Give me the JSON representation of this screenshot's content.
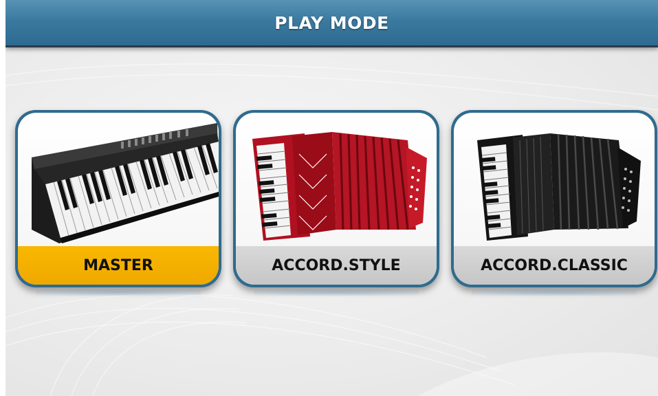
{
  "header": {
    "title": "PLAY MODE"
  },
  "modes": [
    {
      "label": "MASTER",
      "icon": "digital-piano-icon",
      "selected": true
    },
    {
      "label": "ACCORD.STYLE",
      "icon": "red-accordion-icon",
      "selected": false
    },
    {
      "label": "ACCORD.CLASSIC",
      "icon": "black-accordion-icon",
      "selected": false
    }
  ],
  "colors": {
    "header": "#3b7aa0",
    "tile_border": "#2f6b8e",
    "selected_label": "#f5b000",
    "unselected_label": "#cfcfcf"
  }
}
